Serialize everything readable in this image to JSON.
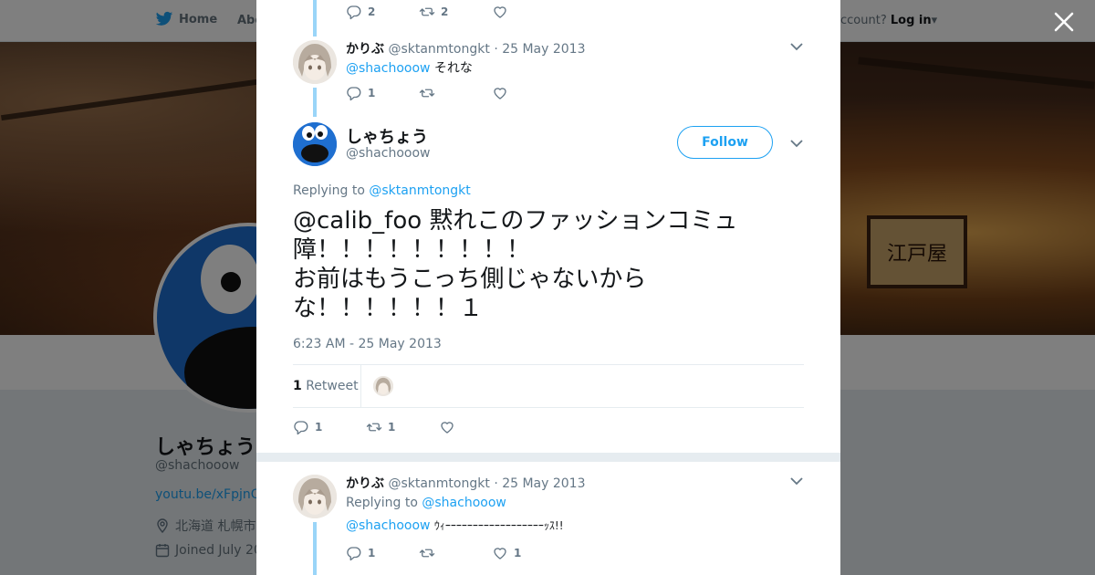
{
  "nav": {
    "home_label": "Home",
    "about_label": "Abo",
    "account_prefix": "ccount?",
    "login_label": "Log in"
  },
  "profile": {
    "name": "しゃちょう",
    "handle": "@shachooow",
    "link": "youtu.be/xFpjnQ",
    "location": "北海道 札幌市",
    "joined": "Joined July 20",
    "banner_sign": "江戸屋"
  },
  "thread": {
    "top_actions": {
      "replies": "2",
      "retweets": "2"
    },
    "reply1": {
      "name": "かりぶ",
      "handle": "@sktanmtongkt",
      "date": "· 25 May 2013",
      "mention": "@shachooow",
      "text": "それな",
      "actions": {
        "replies": "1"
      }
    },
    "main": {
      "name": "しゃちょう",
      "handle": "@shachooow",
      "follow_label": "Follow",
      "replying_label": "Replying to",
      "replying_to": "@sktanmtongkt",
      "text_lines": [
        "@calib_foo 黙れこのファッションコミュ",
        "障！！！！！！！！！",
        "お前はもうこっち側じゃないから",
        "な！！！！！！１"
      ],
      "timestamp": "6:23 AM - 25 May 2013",
      "retweet_count": "1",
      "retweet_label": "Retweet",
      "actions": {
        "replies": "1",
        "retweets": "1"
      }
    },
    "reply2": {
      "name": "かりぶ",
      "handle": "@sktanmtongkt",
      "date": "· 25 May 2013",
      "replying_label": "Replying to",
      "replying_to": "@shachooow",
      "mention": "@shachooow",
      "text": "ｳｨｰｰｰｰｰｰｰｰｰｰｰｰｰｰｰｰｰｰｯｽ!!",
      "actions": {
        "replies": "1",
        "likes": "1"
      }
    }
  },
  "colors": {
    "accent": "#1da1f2",
    "thread_line": "#9ad5f8",
    "muted": "#657786",
    "avatar_blue": "#1f6fd0"
  }
}
